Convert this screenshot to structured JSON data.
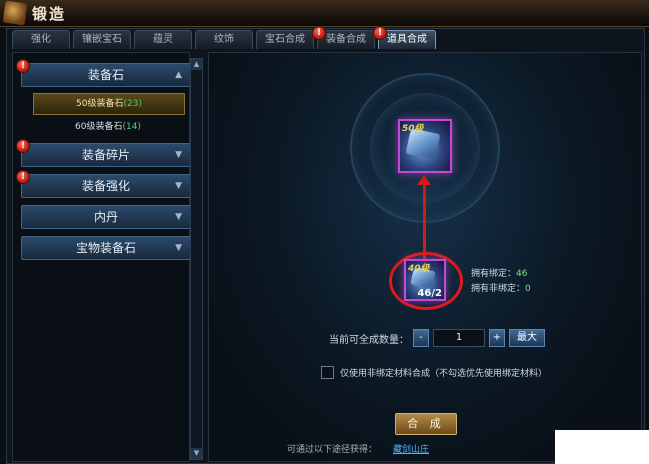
{
  "window": {
    "title": "锻造"
  },
  "tabs": [
    {
      "label": "强化",
      "alert": false
    },
    {
      "label": "镶嵌宝石",
      "alert": false
    },
    {
      "label": "蕴灵",
      "alert": false
    },
    {
      "label": "纹饰",
      "alert": false
    },
    {
      "label": "宝石合成",
      "alert": false
    },
    {
      "label": "装备合成",
      "alert": true
    },
    {
      "label": "道具合成",
      "alert": true,
      "active": true
    }
  ],
  "sidebar": {
    "categories": [
      {
        "label": "装备石",
        "alert": true,
        "expanded": true
      },
      {
        "label": "装备碎片",
        "alert": true
      },
      {
        "label": "装备强化",
        "alert": true
      },
      {
        "label": "内丹",
        "alert": false
      },
      {
        "label": "宝物装备石",
        "alert": false
      }
    ],
    "subitems": [
      {
        "label": "50级装备石",
        "count": "(23)",
        "selected": true
      },
      {
        "label": "60级装备石",
        "count": "(14)",
        "selected": false
      }
    ],
    "alert_glyph": "!"
  },
  "crafting": {
    "target_level": "50级",
    "material_level": "40级",
    "material_qty": "46/2",
    "bound_label": "拥有绑定：",
    "bound_value": "46",
    "unbound_label": "拥有非绑定：",
    "unbound_value": "0"
  },
  "quantity": {
    "label": "当前可全成数量：",
    "minus": "-",
    "value": "1",
    "plus": "+",
    "max": "最大"
  },
  "option": {
    "label": "仅使用非绑定材料合成（不勾选优先使用绑定材料）"
  },
  "synth_button": "合 成",
  "obtain": {
    "label": "可通过以下途径获得：",
    "link": "藏剑山庄"
  },
  "colors": {
    "accent_purple": "#c648d8",
    "highlight_red": "#e01818",
    "count_green": "#4fd16a"
  }
}
